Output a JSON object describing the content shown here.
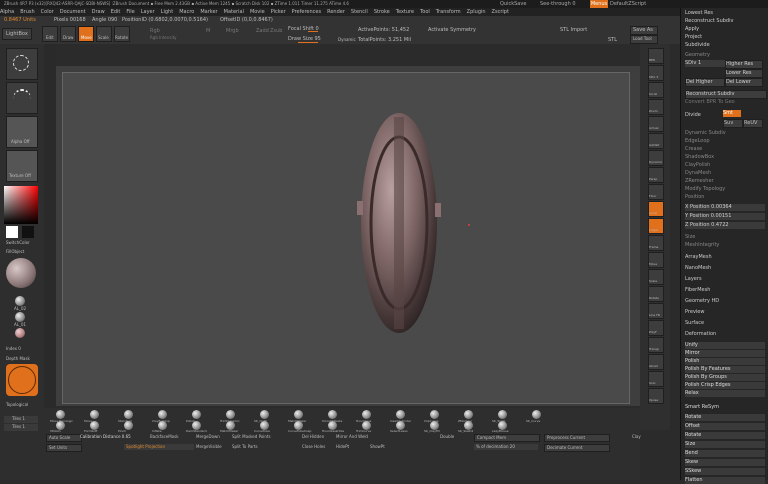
{
  "titlebar": {
    "title": "ZBrush 4R7 P3 (x32)[RXQ42-ASRR-QAJC-SDBI-NSWS] :ZBrush Document ▪ Free Mem 2.43GB ▪ Active Mem 1245 ▪ Scratch Disk 102 ▪ ZTime 1.011 Timer 11.275 ATime 4.6",
    "quicksave": "QuickSave",
    "seethrough": "See-through 0",
    "menus": "Menus",
    "default_script": "DefaultZScript"
  },
  "menubar": [
    "Alpha",
    "Brush",
    "Color",
    "Document",
    "Draw",
    "Edit",
    "File",
    "Layer",
    "Light",
    "Macro",
    "Marker",
    "Material",
    "Movie",
    "Picker",
    "Preferences",
    "Render",
    "Stencil",
    "Stroke",
    "Texture",
    "Tool",
    "Transform",
    "Zplugin",
    "Zscript"
  ],
  "topbar": {
    "units_value": "0.8467 Units",
    "pixels": "Pixels 00168",
    "angle": "Angle 090",
    "position_id": "PositionID (0.6802,0.0070,0.5164)",
    "offset_id": "OffsetID (0,0,0.8467)",
    "lightbox": "LightBox",
    "edit": "Edit",
    "draw": "Draw",
    "move": "Move",
    "scale": "Scale",
    "rotate": "Rotate",
    "rgb": "Rgb",
    "rgb_intensity": "Rgb Intensity",
    "m": "M",
    "mrgb": "Mrgb",
    "zadd": "Zadd",
    "zsub": "Zsub",
    "focal_shift": "Focal Shift 0",
    "draw_size": "Draw Size 95",
    "dynamic": "Dynamic",
    "active_points": "ActivePoints: 51,452",
    "total_points": "TotalPoints: 3.251 Mil",
    "activate_symmetry": "Activate Symmetry",
    "stl_import": "STL Import",
    "stl": "STL",
    "save_as": "Save As",
    "load_tool": "Load Tool"
  },
  "leftbar": {
    "switch_color": "SwitchColor",
    "fill_object": "FillObject",
    "alpha_label": "Alpha",
    "alpha_off": "Alpha Off",
    "texture_off": "Texture Off",
    "mat_label": "Mat",
    "gradient": "Gradient",
    "depth_mask": "Depth Mask",
    "topological": "Topological",
    "tiles1": "Tiles 1",
    "tiles2": "Tiles 1",
    "alt_label1": "AL_02",
    "alt_label2": "AL_01",
    "index": "Index 0"
  },
  "rightshelf": [
    "BPR",
    "SPix 3",
    "Scroll",
    "Zoom",
    "Actual",
    "AAHalf",
    "Dynamic",
    "Persp",
    "Floor",
    "Local",
    "L.Sym",
    "Frame",
    "Move",
    "Scale",
    "Rotate",
    "Line Fill",
    "PolyF",
    "Transp",
    "Ghost",
    "Solo",
    "Xpose"
  ],
  "rightpanel": {
    "top": [
      "Lowest Res",
      "Reconstruct Subdiv",
      "Apply",
      "Project",
      "Subdivide"
    ],
    "groups": [
      "Geometry",
      "SDiv 1",
      "Higher Res",
      "Lower Res",
      "Del Higher",
      "Del Lower",
      "Reconstruct Subdiv",
      "Convert BPR To Geo"
    ],
    "divide": "Divide",
    "smt": "Smt",
    "suv": "Suv",
    "rsuv": "ReUV",
    "items": [
      "Dynamic Subdiv",
      "EdgeLoop",
      "Crease",
      "ShadowBox",
      "ClayPolish",
      "DynaMesh",
      "ZRemesher",
      "Modify Topology",
      "Position"
    ],
    "x_position": "X Position 0.00364",
    "y_position": "Y Position 0.00151",
    "z_position": "Z Position 0.4722",
    "size": "Size",
    "mesh_integrity": "MeshIntegrity",
    "subpanels": [
      "ArrayMesh",
      "NanoMesh",
      "Layers",
      "FiberMesh",
      "Geometry HD",
      "Preview",
      "Surface",
      "Deformation"
    ],
    "deformation": [
      "Unify",
      "Mirror",
      "Polish",
      "Polish By Features",
      "Polish By Groups",
      "Polish Crisp Edges",
      "Relax"
    ],
    "smart_resym": "Smart ReSym",
    "sliders": [
      "Rotate",
      "Offset",
      "Rotate",
      "Size",
      "Bend",
      "Skew",
      "SSkew",
      "Flatten"
    ]
  },
  "brushes": [
    "Move Topologic",
    "Move",
    "Standard",
    "ClayBuildup",
    "Polish",
    "TrimDynamic",
    "SK_Cloth",
    "MatchMaker",
    "SmoothPeaks",
    "HourGlass",
    "InsertCylinder",
    "ClipCurve",
    "ZModeler",
    "SK_Slash",
    "SK_Curve",
    "hPolish",
    "FormSoft",
    "Pinch",
    "Inflate",
    "DamStandard",
    "MatchMaker",
    "CurveTube",
    "CurveTubeSnap",
    "HourGlassHole",
    "TrimCurve",
    "SelectLasso",
    "SK_ClayFill",
    "SK_Slash2",
    "LazyMouse"
  ],
  "bottombar": {
    "auto_scale": "Auto Scale",
    "calibration": "Calibration Distance 0.65",
    "backface": "BackfaceMask",
    "merge_down": "MergeDown",
    "split_masked": "Split Masked Points",
    "del_hidden": "Del Hidden",
    "mirror_and_weld": "Mirror And Weld",
    "double": "Double",
    "compact_mem": "Compact Mem",
    "preprocess": "Preprocess Current",
    "set_units": "Set Units",
    "spotlight": "Spotlight Projection",
    "merge_visible": "MergeVisible",
    "split_to_parts": "Split To Parts",
    "close_holes": "Close Holes",
    "hide_pt": "HidePt",
    "show_pt": "ShowPt",
    "decimation": "% of decimation 20",
    "decimate_current": "Decimate Current",
    "clay": "Clay"
  }
}
